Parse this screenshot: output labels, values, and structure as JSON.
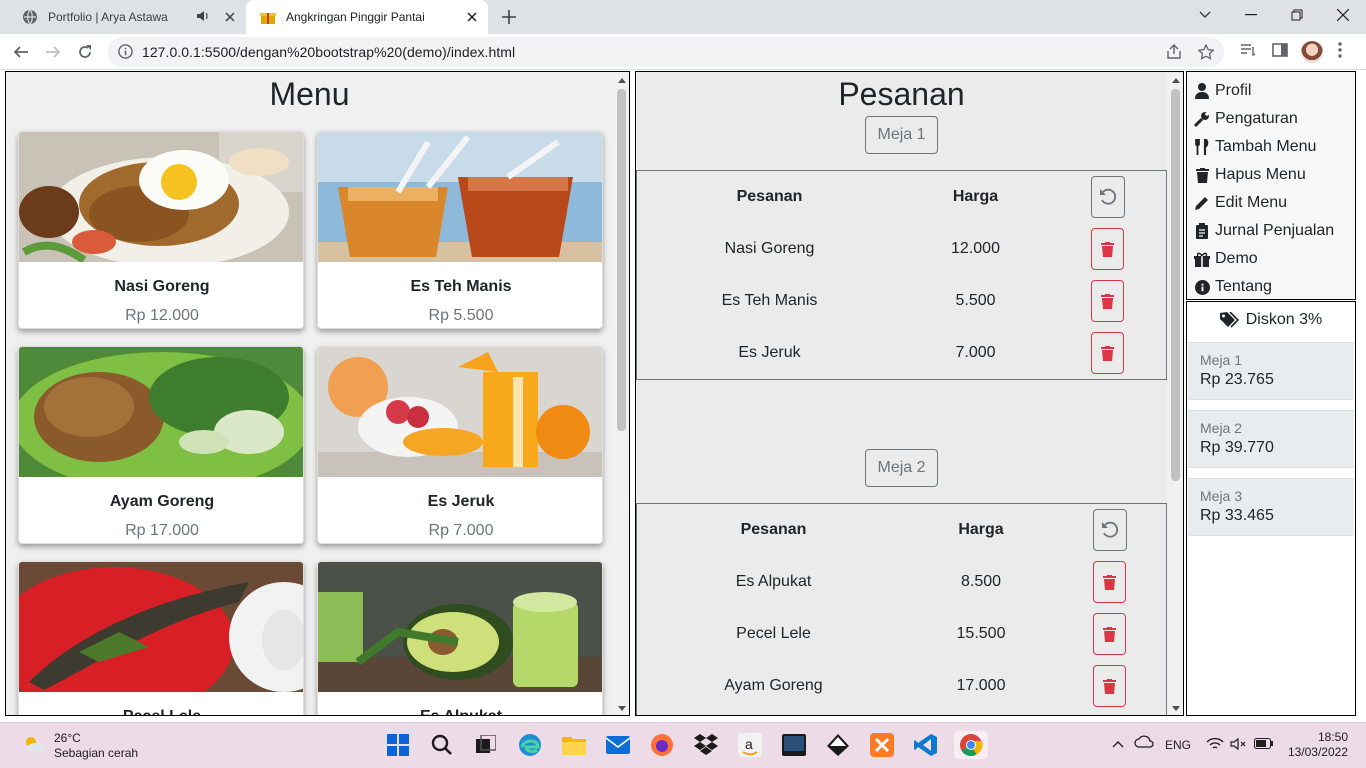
{
  "browser": {
    "tabs": [
      {
        "title": "Portfolio | Arya Astawa",
        "active": false,
        "audio": true
      },
      {
        "title": "Angkringan Pinggir Pantai",
        "active": true,
        "audio": false
      }
    ],
    "url": "127.0.0.1:5500/dengan%20bootstrap%20(demo)/index.html"
  },
  "menu": {
    "title": "Menu",
    "items": [
      {
        "name": "Nasi Goreng",
        "price": "Rp 12.000"
      },
      {
        "name": "Es Teh Manis",
        "price": "Rp 5.500"
      },
      {
        "name": "Ayam Goreng",
        "price": "Rp 17.000"
      },
      {
        "name": "Es Jeruk",
        "price": "Rp 7.000"
      },
      {
        "name": "Pecel Lele",
        "price": ""
      },
      {
        "name": "Es Alpukat",
        "price": ""
      }
    ]
  },
  "pesanan": {
    "title": "Pesanan",
    "col_item": "Pesanan",
    "col_price": "Harga",
    "tables": [
      {
        "label": "Meja 1",
        "rows": [
          {
            "item": "Nasi Goreng",
            "price": "12.000"
          },
          {
            "item": "Es Teh Manis",
            "price": "5.500"
          },
          {
            "item": "Es Jeruk",
            "price": "7.000"
          }
        ]
      },
      {
        "label": "Meja 2",
        "rows": [
          {
            "item": "Es Alpukat",
            "price": "8.500"
          },
          {
            "item": "Pecel Lele",
            "price": "15.500"
          },
          {
            "item": "Ayam Goreng",
            "price": "17.000"
          }
        ]
      }
    ]
  },
  "sidebar": {
    "items": [
      {
        "label": "Profil",
        "icon": "user-icon"
      },
      {
        "label": "Pengaturan",
        "icon": "wrench-icon"
      },
      {
        "label": "Tambah Menu",
        "icon": "utensils-icon"
      },
      {
        "label": "Hapus Menu",
        "icon": "trash-icon"
      },
      {
        "label": "Edit Menu",
        "icon": "pencil-icon"
      },
      {
        "label": "Jurnal Penjualan",
        "icon": "clipboard-icon"
      },
      {
        "label": "Demo",
        "icon": "gift-icon"
      },
      {
        "label": "Tentang",
        "icon": "info-icon"
      }
    ],
    "discount": "Diskon 3%",
    "totals": [
      {
        "label": "Meja 1",
        "value": "Rp 23.765"
      },
      {
        "label": "Meja 2",
        "value": "Rp 39.770"
      },
      {
        "label": "Meja 3",
        "value": "Rp 33.465"
      }
    ]
  },
  "taskbar": {
    "temperature": "26°C",
    "weather": "Sebagian cerah",
    "language": "ENG",
    "time": "18:50",
    "date": "13/03/2022"
  },
  "colors": {
    "danger": "#dc3545",
    "secondary": "#6c757d",
    "panel": "#ebebeb"
  }
}
